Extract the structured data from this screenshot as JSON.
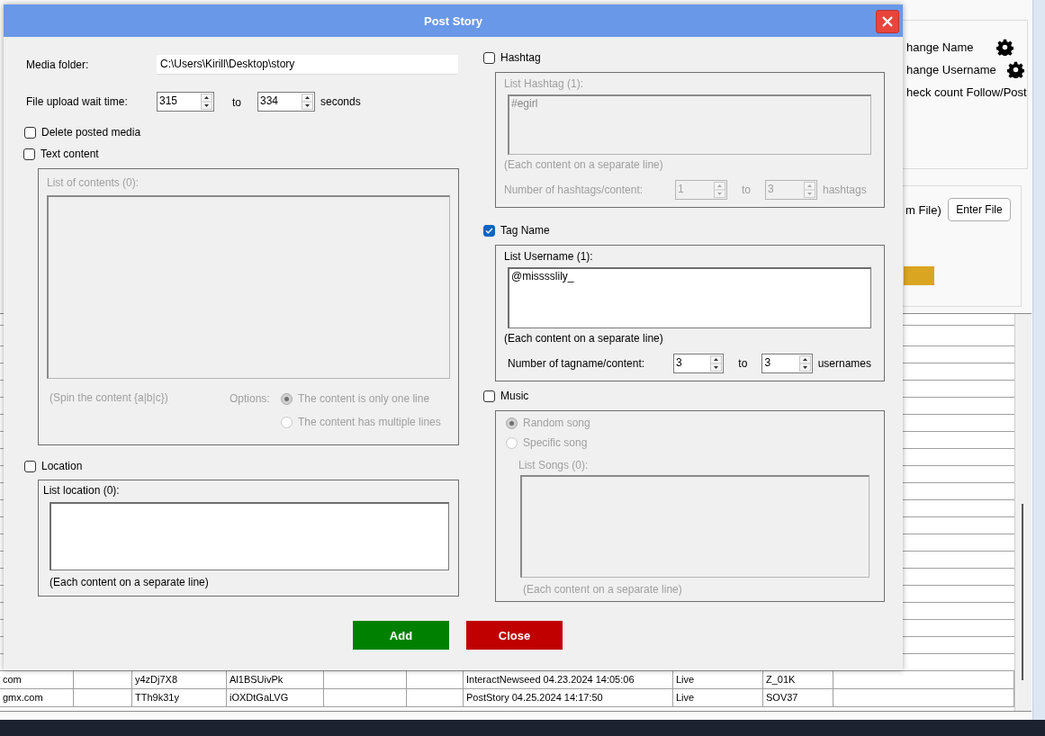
{
  "background": {
    "panel_items": [
      {
        "label": "hange Name",
        "gear": true
      },
      {
        "label": "hange Username",
        "gear": true
      },
      {
        "label": "heck count Follow/Post",
        "gear": false
      }
    ],
    "file_label": "m File)",
    "enter_file_button": "Enter File",
    "table_rows": [
      {
        "column_1": "com",
        "column_3": "y4zDj7X8",
        "column_4": "Al1BSUivPk",
        "column_7": "InteractNewseed 04.23.2024 14:05:06",
        "column_8": "Live",
        "column_9": "Z_01K"
      },
      {
        "column_1": "gmx.com",
        "column_3": "TTh9k31y",
        "column_4": "iOXDtGaLVG",
        "column_7": "PostStory 04.25.2024 14:17:50",
        "column_8": "Live",
        "column_9": "SOV37"
      }
    ]
  },
  "dialog": {
    "title": "Post Story",
    "media_folder": {
      "label": "Media folder:",
      "value": "C:\\Users\\Kirill\\Desktop\\story"
    },
    "wait_time": {
      "label": "File upload wait time:",
      "from": "315",
      "to_label": "to",
      "to": "334",
      "unit": "seconds"
    },
    "delete_posted_media": {
      "label": "Delete posted media",
      "checked": false
    },
    "text_content": {
      "label": "Text content",
      "checked": false,
      "disabled": true,
      "list_label": "List of contents (0):",
      "hint": "(Spin the content {a|b|c})",
      "options_label": "Options:",
      "options": [
        {
          "label": "The content is only one line",
          "selected": true
        },
        {
          "label": "The content has multiple lines",
          "selected": false
        }
      ]
    },
    "location": {
      "label": "Location",
      "checked": false,
      "disabled": false,
      "list_label": "List location (0):",
      "hint": "(Each content on a separate line)"
    },
    "hashtag": {
      "label": "Hashtag",
      "checked": false,
      "disabled": true,
      "list_label": "List Hashtag (1):",
      "value": "#egirl",
      "hint": "(Each content on a separate line)",
      "count_label": "Number of hashtags/content:",
      "from": "1",
      "to_label": "to",
      "to": "3",
      "unit": "hashtags"
    },
    "tag_name": {
      "label": "Tag Name",
      "checked": true,
      "disabled": false,
      "list_label": "List Username (1):",
      "value": "@misssslily_",
      "hint": "(Each content on a separate line)",
      "count_label": "Number of tagname/content:",
      "from": "3",
      "to_label": "to",
      "to": "3",
      "unit": "usernames"
    },
    "music": {
      "label": "Music",
      "checked": false,
      "disabled": true,
      "options": [
        {
          "label": "Random song",
          "selected": true
        },
        {
          "label": "Specific song",
          "selected": false
        }
      ],
      "list_label": "List Songs (0):",
      "hint": "(Each content on a separate line)"
    },
    "buttons": [
      {
        "label": "Add",
        "kind": "add"
      },
      {
        "label": "Close",
        "kind": "close"
      }
    ]
  }
}
